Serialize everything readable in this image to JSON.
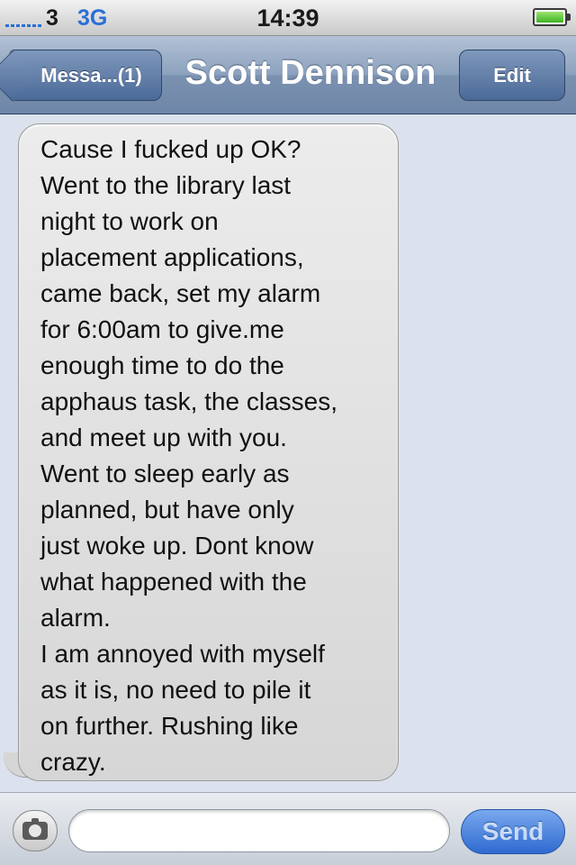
{
  "status_bar": {
    "carrier": "3",
    "network": "3G",
    "time": "14:39"
  },
  "nav": {
    "back_label": "Messa...(1)",
    "title": "Scott Dennison",
    "edit_label": "Edit"
  },
  "conversation": {
    "messages": [
      {
        "direction": "incoming",
        "text": "Cause I fucked up OK?\nWent to the library last\nnight to work on\nplacement applications,\ncame back, set my alarm\nfor 6:00am to give.me\nenough time to do the\napphaus task, the classes,\nand meet up with you.\nWent to sleep early as\nplanned, but have only\njust woke up. Dont know\nwhat happened with the\nalarm.\nI am annoyed with myself\nas it is,  no need to pile it\non further. Rushing like\ncrazy."
      }
    ]
  },
  "input_bar": {
    "camera_icon": "camera-icon",
    "input_value": "",
    "send_label": "Send"
  },
  "colors": {
    "nav_blue": "#7b91b0",
    "send_blue": "#2e6ad0",
    "bubble_gray": "#d6d6d6",
    "background": "#dbe2ed"
  }
}
